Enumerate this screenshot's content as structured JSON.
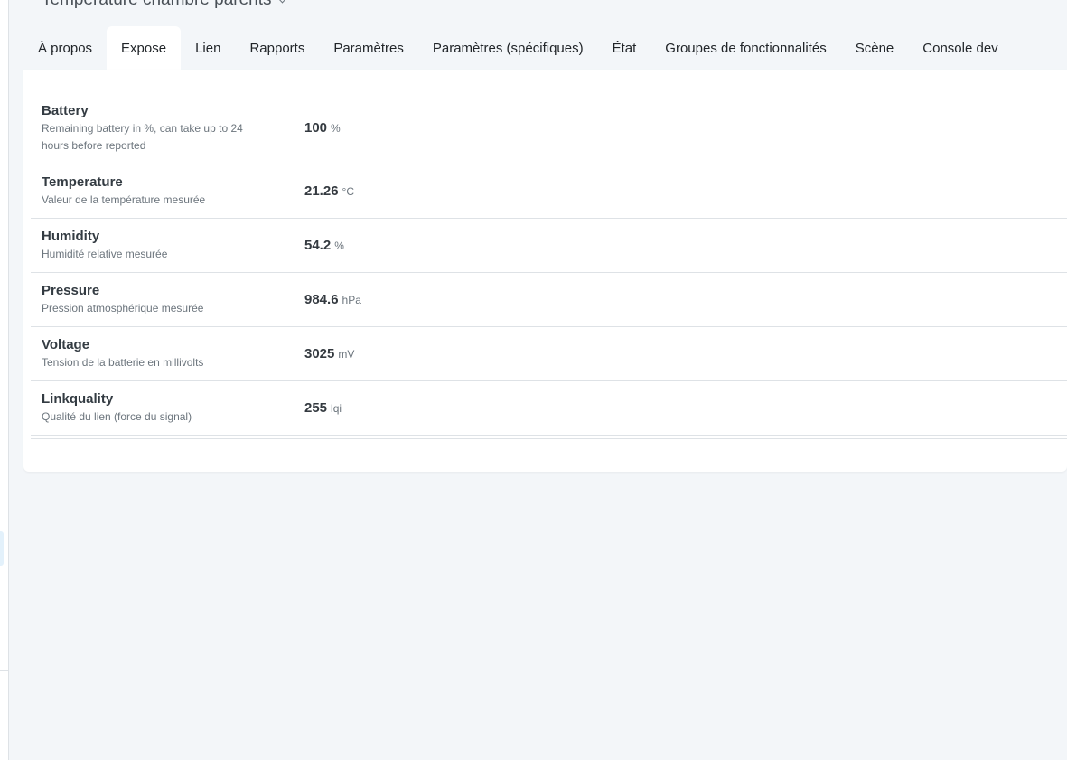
{
  "device": {
    "title": "Température chambre parents"
  },
  "tabs": [
    {
      "label": "À propos",
      "active": false
    },
    {
      "label": "Expose",
      "active": true
    },
    {
      "label": "Lien",
      "active": false
    },
    {
      "label": "Rapports",
      "active": false
    },
    {
      "label": "Paramètres",
      "active": false
    },
    {
      "label": "Paramètres (spécifiques)",
      "active": false
    },
    {
      "label": "État",
      "active": false
    },
    {
      "label": "Groupes de fonctionnalités",
      "active": false
    },
    {
      "label": "Scène",
      "active": false
    },
    {
      "label": "Console dev",
      "active": false
    }
  ],
  "exposes": [
    {
      "name": "Battery",
      "description": "Remaining battery in %, can take up to 24 hours before reported",
      "value": "100",
      "unit": "%"
    },
    {
      "name": "Temperature",
      "description": "Valeur de la température mesurée",
      "value": "21.26",
      "unit": "°C"
    },
    {
      "name": "Humidity",
      "description": "Humidité relative mesurée",
      "value": "54.2",
      "unit": "%"
    },
    {
      "name": "Pressure",
      "description": "Pression atmosphérique mesurée",
      "value": "984.6",
      "unit": "hPa"
    },
    {
      "name": "Voltage",
      "description": "Tension de la batterie en millivolts",
      "value": "3025",
      "unit": "mV"
    },
    {
      "name": "Linkquality",
      "description": "Qualité du lien (force du signal)",
      "value": "255",
      "unit": "lqi"
    }
  ]
}
